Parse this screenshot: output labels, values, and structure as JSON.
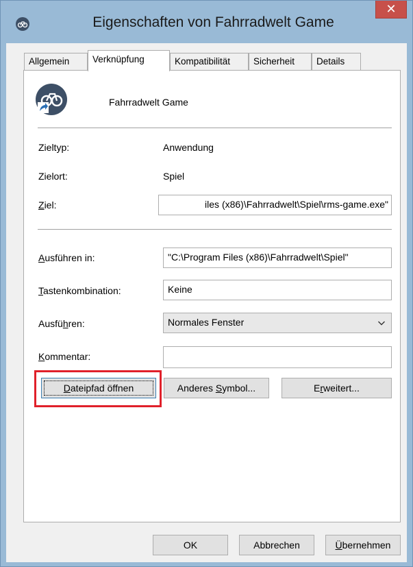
{
  "window": {
    "title": "Eigenschaften von Fahrradwelt Game",
    "close_label": "✕",
    "accent": "#99bad6",
    "close_color": "#c7504a"
  },
  "tabs": [
    {
      "label": "Allgemein",
      "active": false
    },
    {
      "label": "Verknüpfung",
      "active": true
    },
    {
      "label": "Kompatibilität",
      "active": false
    },
    {
      "label": "Sicherheit",
      "active": false
    },
    {
      "label": "Details",
      "active": false
    }
  ],
  "shortcut": {
    "name": "Fahrradwelt Game",
    "icon": "bike-shortcut-icon",
    "target_type_label": "Zieltyp:",
    "target_type_value": "Anwendung",
    "target_location_label": "Zielort:",
    "target_location_value": "Spiel",
    "target_label_key": "Z",
    "target_label_rest": "iel:",
    "target_value": "iles (x86)\\Fahrradwelt\\Spiel\\rms-game.exe\"",
    "start_in_label_key": "A",
    "start_in_label_rest": "usführen in:",
    "start_in_value": "\"C:\\Program Files (x86)\\Fahrradwelt\\Spiel\"",
    "hotkey_label_key": "T",
    "hotkey_label_rest": "astenkombination:",
    "hotkey_value": "Keine",
    "run_label_pre": "Ausfü",
    "run_label_key": "h",
    "run_label_rest": "ren:",
    "run_value": "Normales Fenster",
    "comment_label_key": "K",
    "comment_label_rest": "ommentar:",
    "comment_value": ""
  },
  "buttons": {
    "open_path_key": "D",
    "open_path_rest": "ateipfad öffnen",
    "change_icon_pre": "Anderes ",
    "change_icon_key": "S",
    "change_icon_rest": "ymbol...",
    "advanced_pre": "E",
    "advanced_key": "r",
    "advanced_rest": "weitert...",
    "ok": "OK",
    "cancel": "Abbrechen",
    "apply_key": "Ü",
    "apply_rest": "bernehmen"
  },
  "highlight_color": "#e0202a"
}
